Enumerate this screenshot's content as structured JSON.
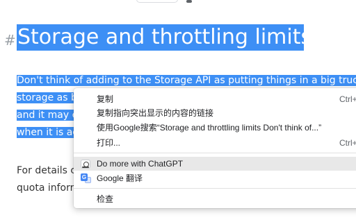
{
  "article": {
    "heading_marker": "#",
    "heading": "Storage and throttling limits",
    "selected_lines": [
      "Don't think of adding to the Storage API as putting things in a big truck.",
      "storage as b",
      "and it may e",
      "when it is ac"
    ],
    "body_lines": [
      "For details c",
      "quota inforr"
    ]
  },
  "context_menu": {
    "copy": {
      "label": "复制",
      "shortcut": "Ctrl+"
    },
    "copy_link_to_highlight": {
      "label": "复制指向突出显示的内容的链接"
    },
    "search_google": {
      "label": "使用Google搜索“Storage and throttling limits Don't think of...”"
    },
    "print": {
      "label": "打印...",
      "shortcut": "Ctrl+"
    },
    "chatgpt": {
      "label": "Do more with ChatGPT",
      "icon": "chatgpt-extension-icon"
    },
    "google_translate": {
      "label": "Google 翻译",
      "icon": "google-translate-icon"
    },
    "inspect": {
      "label": "检查"
    }
  },
  "colors": {
    "selection": "#3d8ff5",
    "menu_hover": "#e8e8e8",
    "separator": "#e0e0e0"
  }
}
